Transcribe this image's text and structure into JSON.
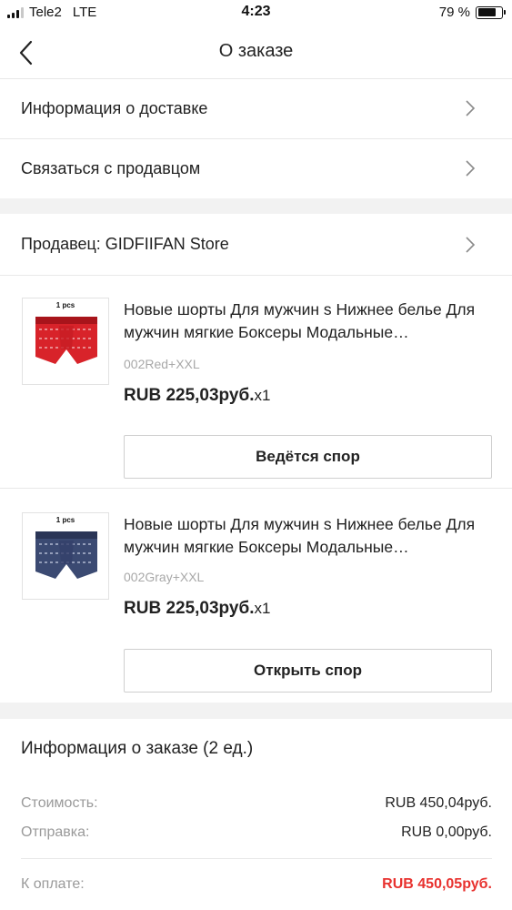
{
  "status_bar": {
    "carrier": "Tele2",
    "network": "LTE",
    "time": "4:23",
    "battery": "79 %",
    "battery_level": 0.79
  },
  "header": {
    "title": "О заказе",
    "back_icon": "chevron-left-icon"
  },
  "menu": {
    "delivery_info": "Информация о доставке",
    "contact_seller": "Связаться с продавцом",
    "seller": "Продавец: GIDFIIFAN Store"
  },
  "products": [
    {
      "image_label": "1 pcs",
      "title": "Новые шорты Для мужчин s Нижнее белье Для мужчин мягкие Боксеры Модальные…",
      "variant": "002Red+XXL",
      "price": "RUB 225,03руб.",
      "qty": "x1",
      "action": "Ведётся спор",
      "color": "#d8232a"
    },
    {
      "image_label": "1 pcs",
      "title": "Новые шорты Для мужчин s Нижнее белье Для мужчин мягкие Боксеры Модальные…",
      "variant": "002Gray+XXL",
      "price": "RUB 225,03руб.",
      "qty": "x1",
      "action": "Открыть спор",
      "color": "#3b4a72"
    }
  ],
  "summary": {
    "title": "Информация о заказе (2 ед.)",
    "cost_label": "Стоимость:",
    "cost_value": "RUB 450,04руб.",
    "shipping_label": "Отправка:",
    "shipping_value": "RUB 0,00руб.",
    "total_label": "К оплате:",
    "total_value": "RUB 450,05руб."
  },
  "colors": {
    "accent_red": "#e8322f",
    "divider": "#e8e8e8",
    "section_gap": "#f2f2f2"
  }
}
